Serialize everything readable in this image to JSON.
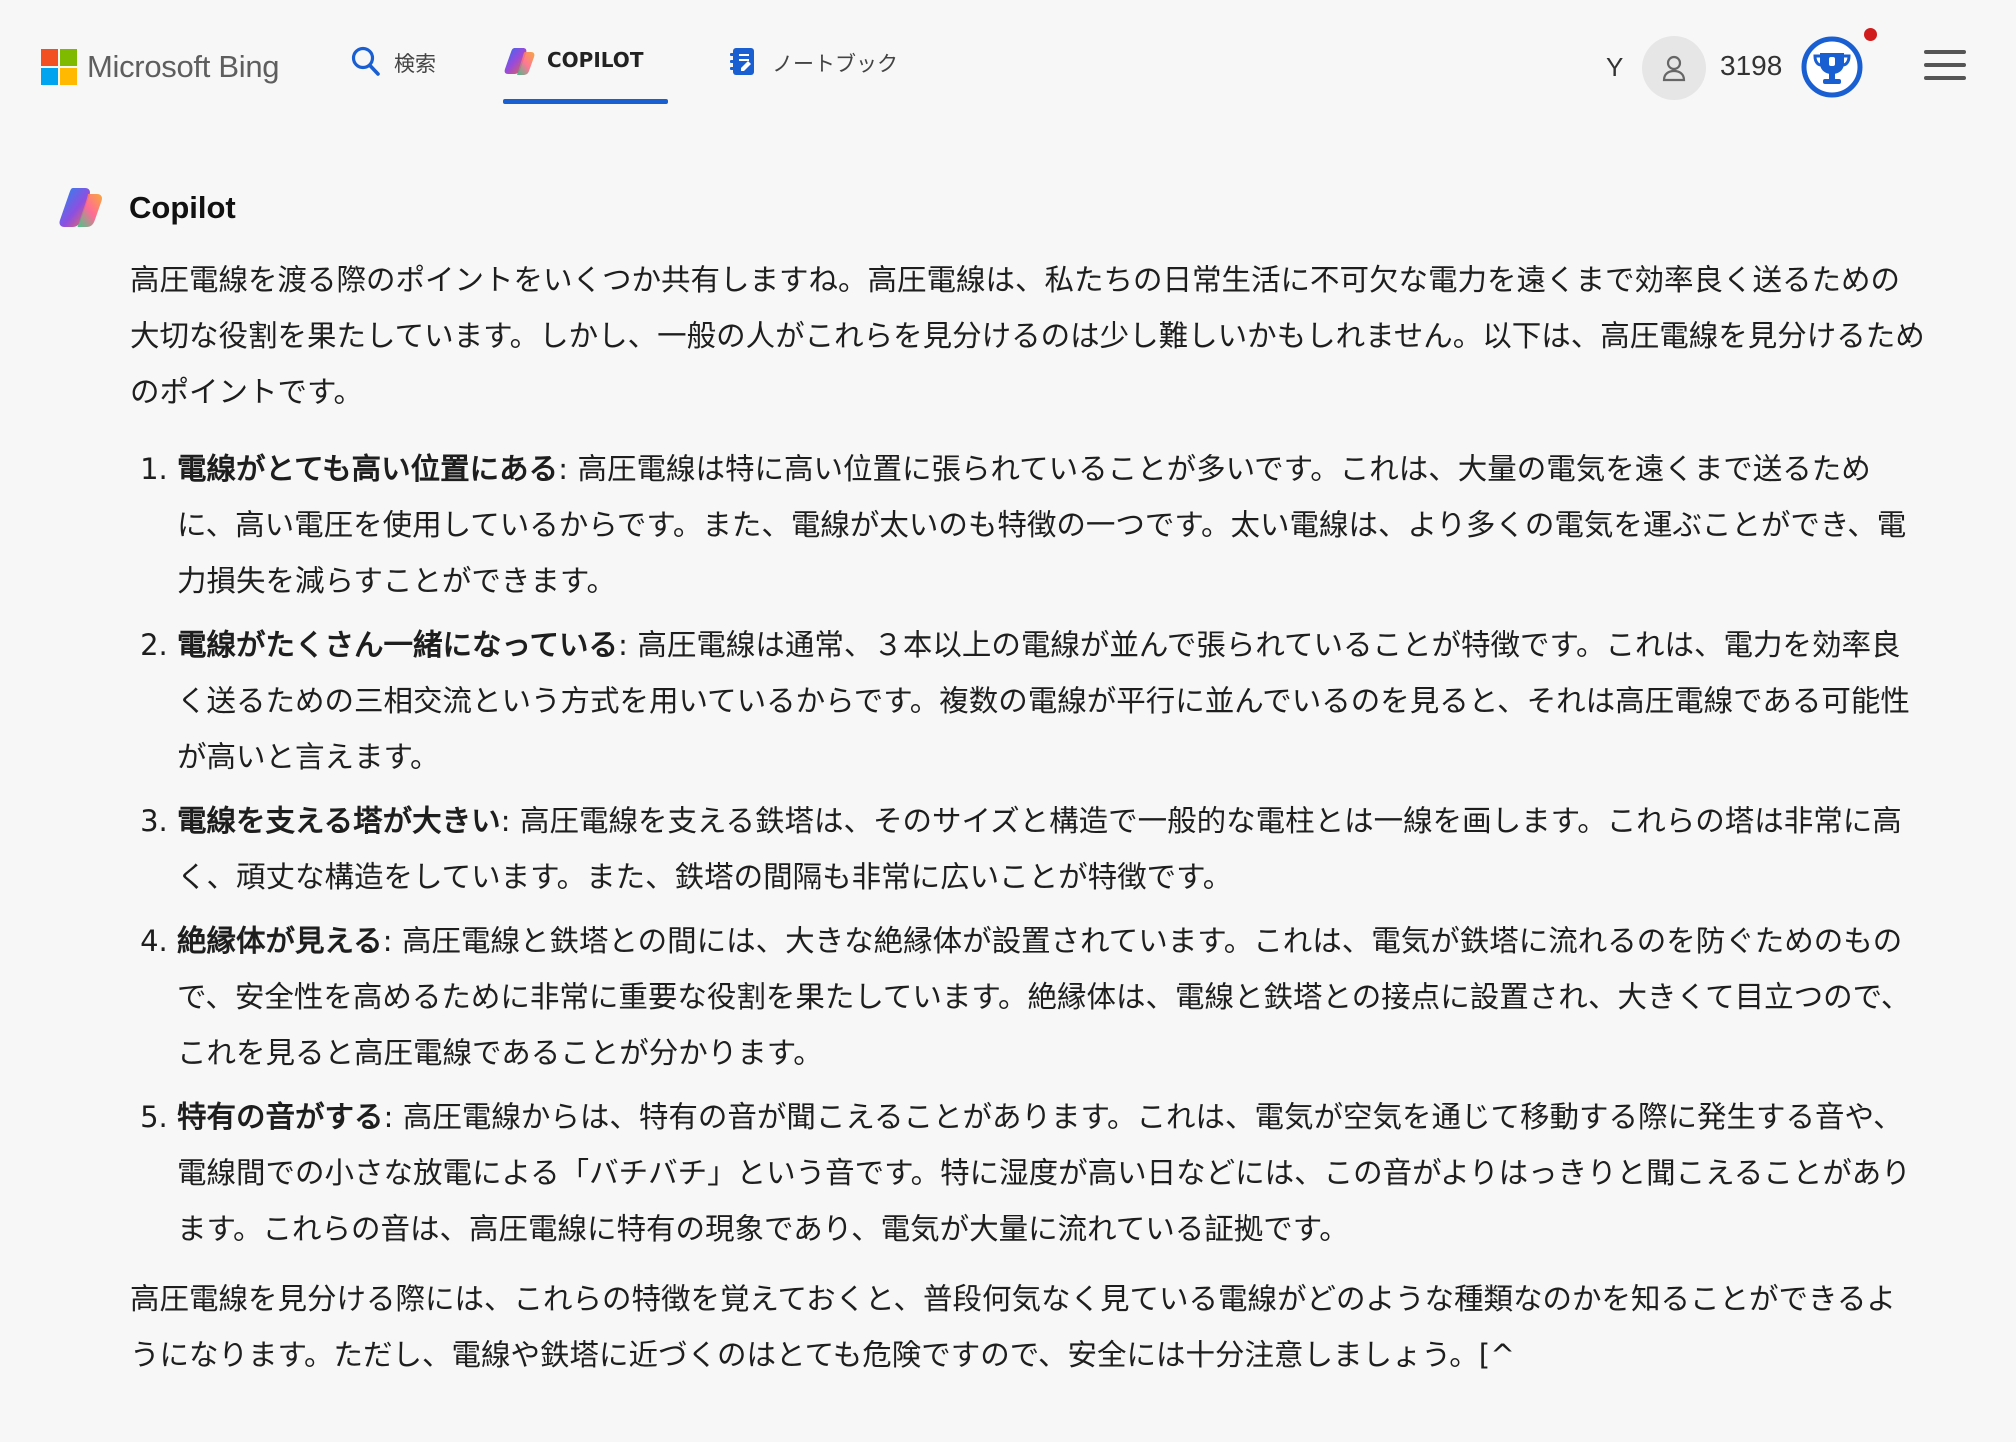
{
  "header": {
    "brand": "Microsoft Bing",
    "tabs": [
      {
        "label": "検索",
        "icon": "search-icon"
      },
      {
        "label": "COPILOT",
        "icon": "copilot-icon",
        "active": true
      },
      {
        "label": "ノートブック",
        "icon": "notebook-icon"
      }
    ],
    "user_initial": "Y",
    "reward_points": "3198"
  },
  "message": {
    "sender": "Copilot",
    "intro": "高圧電線を渡る際のポイントをいくつか共有しますね。高圧電線は、私たちの日常生活に不可欠な電力を遠くまで効率良く送るための大切な役割を果たしています。しかし、一般の人がこれらを見分けるのは少し難しいかもしれません。以下は、高圧電線を見分けるためのポイントです。",
    "points": [
      {
        "title": "電線がとても高い位置にある",
        "text": ": 高圧電線は特に高い位置に張られていることが多いです。これは、大量の電気を遠くまで送るために、高い電圧を使用しているからです。また、電線が太いのも特徴の一つです。太い電線は、より多くの電気を運ぶことができ、電力損失を減らすことができます。"
      },
      {
        "title": "電線がたくさん一緒になっている",
        "text": ": 高圧電線は通常、３本以上の電線が並んで張られていることが特徴です。これは、電力を効率良く送るための三相交流という方式を用いているからです。複数の電線が平行に並んでいるのを見ると、それは高圧電線である可能性が高いと言えます。"
      },
      {
        "title": "電線を支える塔が大きい",
        "text": ": 高圧電線を支える鉄塔は、そのサイズと構造で一般的な電柱とは一線を画します。これらの塔は非常に高く、頑丈な構造をしています。また、鉄塔の間隔も非常に広いことが特徴です。"
      },
      {
        "title": "絶縁体が見える",
        "text": ": 高圧電線と鉄塔との間には、大きな絶縁体が設置されています。これは、電気が鉄塔に流れるのを防ぐためのもので、安全性を高めるために非常に重要な役割を果たしています。絶縁体は、電線と鉄塔との接点に設置され、大きくて目立つので、これを見ると高圧電線であることが分かります。"
      },
      {
        "title": "特有の音がする",
        "text": ": 高圧電線からは、特有の音が聞こえることがあります。これは、電気が空気を通じて移動する際に発生する音や、電線間での小さな放電による「バチバチ」という音です。特に湿度が高い日などには、この音がよりはっきりと聞こえることがあります。これらの音は、高圧電線に特有の現象であり、電気が大量に流れている証拠です。"
      }
    ],
    "outro": "高圧電線を見分ける際には、これらの特徴を覚えておくと、普段何気なく見ている電線がどのような種類なのかを知ることができるようになります。ただし、電線や鉄塔に近づくのはとても危険ですので、安全には十分注意しましょう。[^"
  },
  "colors": {
    "background": "#f7f7f7",
    "accent": "#1a5fd1",
    "notification": "#d01c1c",
    "ms_red": "#f25022",
    "ms_green": "#7fba00",
    "ms_blue": "#00a4ef",
    "ms_yellow": "#ffb900"
  }
}
